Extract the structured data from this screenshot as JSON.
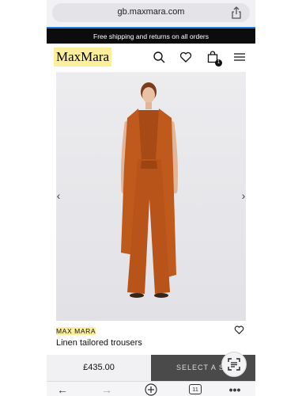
{
  "browser": {
    "url": "gb.maxmara.com",
    "open_tabs": "11"
  },
  "promo": {
    "text": "Free shipping and returns on all orders"
  },
  "header": {
    "logo": "MaxMara",
    "bag_count": "1"
  },
  "product": {
    "brand": "MAX MARA",
    "title": "Linen tailored trousers",
    "price": "£435.00",
    "select_size_label": "SELECT A SIZE"
  },
  "colors": {
    "promo_bg": "#0c0c0c",
    "highlight": "#fbef9c",
    "garment": "#c05a1c",
    "cta_dark": "#4a4a4a"
  },
  "icons": [
    "share-icon",
    "search-icon",
    "heart-icon",
    "bag-icon",
    "menu-icon",
    "chevron-left-icon",
    "chevron-right-icon",
    "lens-icon",
    "back-icon",
    "forward-icon",
    "plus-icon",
    "tabs-icon",
    "more-icon"
  ]
}
